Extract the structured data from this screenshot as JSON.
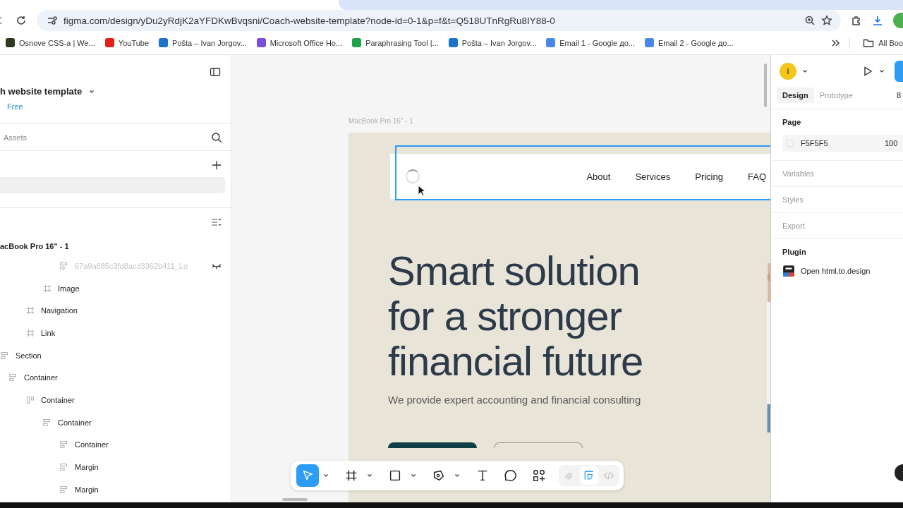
{
  "browser": {
    "url": "figma.com/design/yDu2yRdjK2aYFDKwBvqsni/Coach-website-template?node-id=0-1&p=f&t=Q518UTnRgRu8IY88-0",
    "bookmarks": [
      {
        "label": "Osnove CSS-a | We...",
        "color": "#2e3a1f"
      },
      {
        "label": "YouTube",
        "color": "#e62117"
      },
      {
        "label": "Pošta – Ivan Jorgov...",
        "color": "#1a73c8"
      },
      {
        "label": "Microsoft Office Ho...",
        "color": "#7b4fd6"
      },
      {
        "label": "Paraphrasing Tool |...",
        "color": "#1fa34a"
      },
      {
        "label": "Pošta – Ivan Jorgov...",
        "color": "#1a73c8"
      },
      {
        "label": "Email 1 - Google до...",
        "color": "#4a86e8"
      },
      {
        "label": "Email 2 - Google до...",
        "color": "#4a86e8"
      }
    ],
    "all_bookmarks": "All Boo"
  },
  "left_panel": {
    "file_title": "h website template",
    "plan": "Free",
    "assets_tab": "Assets",
    "frame_name": "acBook Pro 16\" - 1",
    "layers": [
      {
        "children": [
          {
            "children": [
              {
                "children": [
                  {
                    "children": [
                      {
                        "name": "67a9a685c3fd8acd3362b411_Lo",
                        "kind": "stack",
                        "hidden": true
                      }
                    ]
                  },
                  {
                    "name": "Image",
                    "kind": "frame",
                    "hidden": false
                  }
                ]
              },
              {
                "name": "Navigation",
                "kind": "frame",
                "hidden": false
              },
              {
                "name": "Link",
                "kind": "frame",
                "hidden": false
              }
            ]
          }
        ]
      },
      {
        "name": "Section",
        "kind": "stack",
        "hidden": false,
        "children": [
          {
            "name": "Container",
            "kind": "stack",
            "hidden": false,
            "children": [
              {
                "name": "Container",
                "kind": "column",
                "hidden": false,
                "children": [
                  {
                    "name": "Container",
                    "kind": "stack",
                    "hidden": false,
                    "children": [
                      {
                        "name": "Container",
                        "kind": "stack",
                        "hidden": false
                      },
                      {
                        "name": "Margin",
                        "kind": "stack",
                        "hidden": false
                      },
                      {
                        "name": "Margin",
                        "kind": "stack",
                        "hidden": false
                      }
                    ]
                  }
                ]
              }
            ]
          }
        ]
      }
    ]
  },
  "canvas": {
    "frame_label": "MacBook Pro 16\" - 1",
    "nav_links": [
      "About",
      "Services",
      "Pricing",
      "FAQ"
    ],
    "heading": "Smart solution for a stronger financial future",
    "subtitle": "We provide expert accounting and financial consulting",
    "toolbar": [
      {
        "kind": "move",
        "selected": true,
        "menu": true
      },
      {
        "kind": "frame",
        "selected": false,
        "menu": true
      },
      {
        "kind": "rect",
        "selected": false,
        "menu": true
      },
      {
        "kind": "pen",
        "selected": false,
        "menu": true
      },
      {
        "kind": "text",
        "selected": false,
        "menu": false
      },
      {
        "kind": "comment",
        "selected": false,
        "menu": false
      },
      {
        "kind": "actions",
        "selected": false,
        "menu": false
      }
    ],
    "modes": [
      {
        "kind": "draw",
        "selected": false
      },
      {
        "kind": "design",
        "selected": true
      },
      {
        "kind": "dev",
        "selected": false
      }
    ]
  },
  "right_panel": {
    "avatar": "I",
    "tabs": [
      {
        "label": "Design",
        "selected": true
      },
      {
        "label": "Prototype",
        "selected": false
      }
    ],
    "zoom": "8",
    "page": {
      "title": "Page",
      "color": "F5F5F5",
      "opacity": "100"
    },
    "sections": [
      "Variables",
      "Styles",
      "Export"
    ],
    "plugin": {
      "title": "Plugin",
      "item": "Open html.to.design"
    }
  }
}
